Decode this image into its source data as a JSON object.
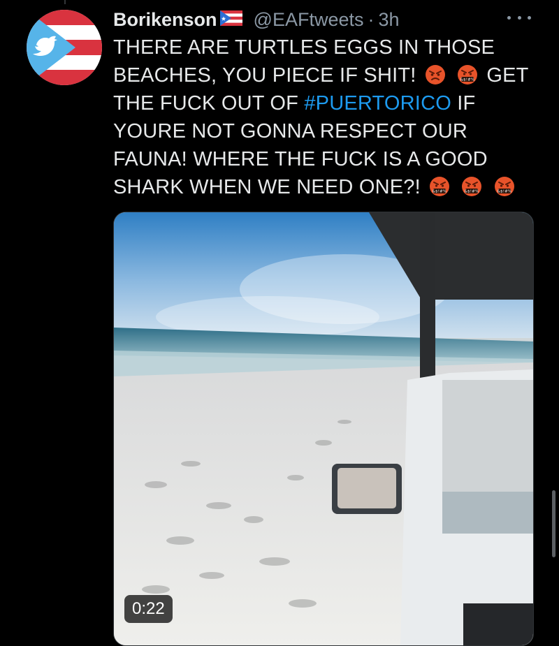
{
  "tweet": {
    "author": "Borikenson",
    "handle": "@EAFtweets",
    "separator": "·",
    "time": "3h",
    "text": {
      "line1": "THERE ARE TURTLES EGGS IN THOSE",
      "line2a": "BEACHES, YOU PIECE IF SHIT!",
      "line2b": "GET",
      "line3a": "THE FUCK OUT OF",
      "hashtag": "#PUERTORICO",
      "line3b": "IF",
      "line4": "YOURE NOT GONNA RESPECT OUR",
      "line5": "FAUNA! WHERE THE FUCK IS A GOOD",
      "line6": "SHARK WHEN WE NEED ONE?!"
    },
    "emoji": {
      "angry": "angry-face-emoji",
      "cursing": "face-with-symbols-on-mouth-emoji",
      "cursing_symbols": "&$!#%"
    },
    "media": {
      "type": "video",
      "duration": "0:22"
    }
  },
  "colors": {
    "background": "#000000",
    "text": "#e7e9ea",
    "secondary_text": "#8b98a5",
    "link": "#1d9bf0",
    "flag_red": "#d9333f",
    "flag_blue": "#56b4e9"
  },
  "icons": {
    "avatar": "puerto-rico-flag-twitter-bird-avatar",
    "verified_flag": "puerto-rico-flag-icon",
    "more": "more-options-icon"
  }
}
